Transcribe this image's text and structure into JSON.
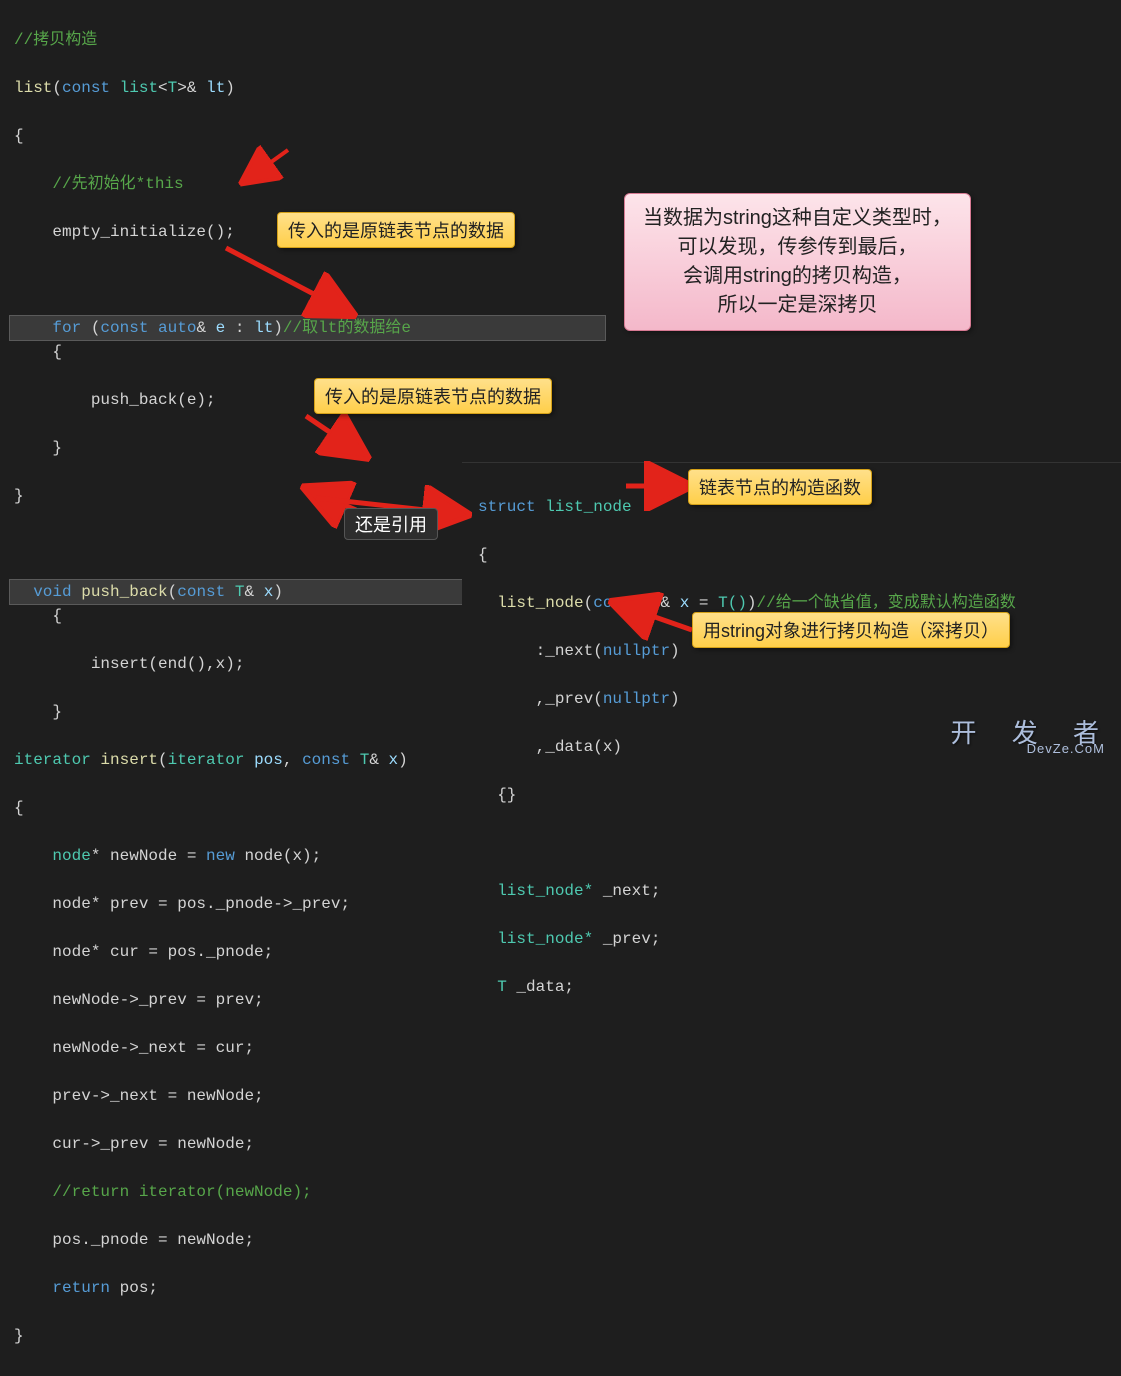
{
  "left_code": {
    "comment_copy": "//拷贝构造",
    "fn_list": "list",
    "list_sig_open": "(",
    "list_param_const": "const",
    "list_param_type": "list",
    "list_param_tpl_open": "<",
    "list_param_tpl_T": "T",
    "list_param_tpl_close": ">",
    "list_param_amp": "&",
    "list_param_name": "lt",
    "list_sig_close": ")",
    "brace_open1": "{",
    "comment_init": "//先初始化*this",
    "empty_init": "empty_initialize();",
    "for_kw": "for",
    "for_open": " (",
    "for_const": "const",
    "for_auto": "auto",
    "for_amp": "&",
    "for_e": "e",
    "for_colon": " : ",
    "for_lt": "lt",
    "for_close": ")",
    "for_comment": "//取lt的数据给e",
    "brace_open2": "{",
    "push_back_call": "push_back(e);",
    "brace_close2": "}",
    "brace_close1": "}",
    "void_kw": "void",
    "push_back_fn": "push_back",
    "push_back_open": "(",
    "pb_const": "const",
    "pb_T": "T",
    "pb_amp": "&",
    "pb_x": "x",
    "push_back_close": ")",
    "pb_brace_open": "{",
    "insert_call": "insert(end(),x);",
    "pb_brace_close": "}",
    "iterator_kw": "iterator",
    "insert_fn": "insert",
    "insert_open": "(",
    "insert_iter": "iterator",
    "insert_pos": "pos",
    "insert_comma": ", ",
    "insert_const": "const",
    "insert_T": "T",
    "insert_amp": "&",
    "insert_x": "x",
    "insert_close": ")",
    "ins_brace_open": "{",
    "l_node1": "node* newNode = ",
    "new_kw": "new",
    "l_node1b": " node(x);",
    "l_node2": "node* prev = pos._pnode->_prev;",
    "l_node3": "node* cur = pos._pnode;",
    "l_node4": "newNode->_prev = prev;",
    "l_node5": "newNode->_next = cur;",
    "l_node6": "prev->_next = newNode;",
    "l_node7": "cur->_prev = newNode;",
    "l_comment_ret": "//return iterator(newNode);",
    "l_node8": "pos._pnode = newNode;",
    "l_ret": "return",
    "l_ret_pos": " pos;",
    "ins_brace_close": "}"
  },
  "right_code": {
    "struct_kw": "struct",
    "list_node": "list_node",
    "brace_open": "{",
    "ctor_name": "list_node",
    "ctor_open": "(",
    "ctor_const": "const",
    "ctor_T": "T",
    "ctor_amp": "&",
    "ctor_x": "x",
    "ctor_eq": " = ",
    "ctor_Tcall": "T()",
    "ctor_close": ")",
    "ctor_comment": "//给一个缺省值，变成默认构造函数",
    "init1": ":_next(",
    "nullptr1": "nullptr",
    "init1_close": ")",
    "init2": ",_prev(",
    "nullptr2": "nullptr",
    "init2_close": ")",
    "init3": ",_data(x)",
    "body": "{}",
    "m1_a": "list_node* ",
    "m1_b": "_next;",
    "m2_a": "list_node* ",
    "m2_b": "_prev;",
    "m3_a": "T ",
    "m3_b": "_data;"
  },
  "callouts": {
    "c1": "传入的是原链表节点的数据",
    "c2": "传入的是原链表节点的数据",
    "c3": "还是引用",
    "c4": "链表节点的构造函数",
    "c5": "用string对象进行拷贝构造（深拷贝）",
    "pink1": "当数据为string这种自定义类型时，",
    "pink2": "可以发现，传参传到最后，",
    "pink3": "会调用string的拷贝构造，",
    "pink4": "所以一定是深拷贝"
  },
  "watermark": {
    "cn": "开 发 者",
    "en": "DevZe.CoM"
  }
}
